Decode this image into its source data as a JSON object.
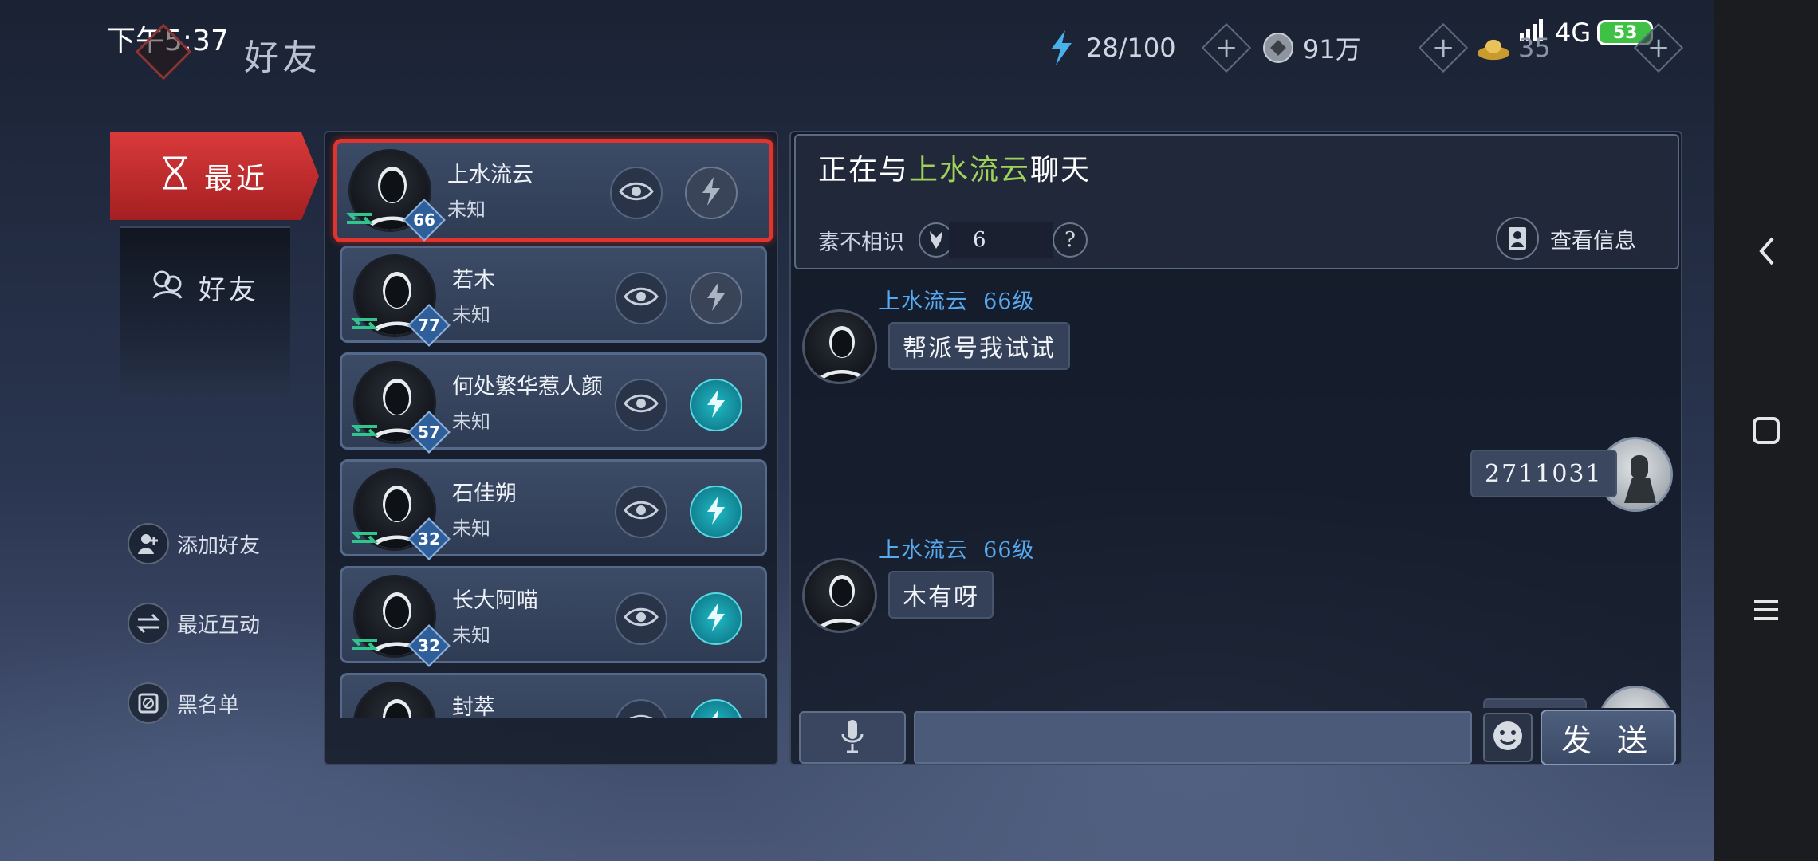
{
  "status": {
    "time": "下午5:37",
    "network": "4G",
    "battery": "53"
  },
  "header": {
    "title": "好友"
  },
  "resources": [
    {
      "icon": "lightning-icon",
      "value": "28/100"
    },
    {
      "icon": "coin-icon",
      "value": "91万"
    },
    {
      "icon": "gold-ingot-icon",
      "value": "35"
    }
  ],
  "tabs": {
    "recent": "最近",
    "friends": "好友"
  },
  "side_actions": {
    "add": "添加好友",
    "interact": "最近互动",
    "blacklist": "黑名单"
  },
  "friends": [
    {
      "name": "上水流云",
      "status": "未知",
      "level": "66",
      "selected": true,
      "action_active": false
    },
    {
      "name": "若木",
      "status": "未知",
      "level": "77",
      "selected": false,
      "action_active": false
    },
    {
      "name": "何处繁华惹人颜",
      "status": "未知",
      "level": "57",
      "selected": false,
      "action_active": true
    },
    {
      "name": "石佳朔",
      "status": "未知",
      "level": "32",
      "selected": false,
      "action_active": true
    },
    {
      "name": "长大阿喵",
      "status": "未知",
      "level": "32",
      "selected": false,
      "action_active": true
    },
    {
      "name": "封萃",
      "status": "",
      "level": "",
      "selected": false,
      "action_active": true
    }
  ],
  "chat": {
    "title_prefix": "正在与",
    "partner": "上水流云",
    "title_suffix": "聊天",
    "relation": "素不相识",
    "intimacy": "6",
    "help": "?",
    "view_info": "查看信息",
    "messages": [
      {
        "from": "other",
        "name": "上水流云",
        "level": "66级",
        "text": "帮派号我试试"
      },
      {
        "from": "me",
        "text": "2711031"
      },
      {
        "from": "other",
        "name": "上水流云",
        "level": "66级",
        "text": "木有呀"
      }
    ],
    "input_placeholder": "",
    "send": "发 送"
  },
  "colors": {
    "accent_red": "#e0352e",
    "highlight_green": "#9fd25a",
    "name_blue": "#57a9f0",
    "active_teal": "#1fb9c4"
  }
}
